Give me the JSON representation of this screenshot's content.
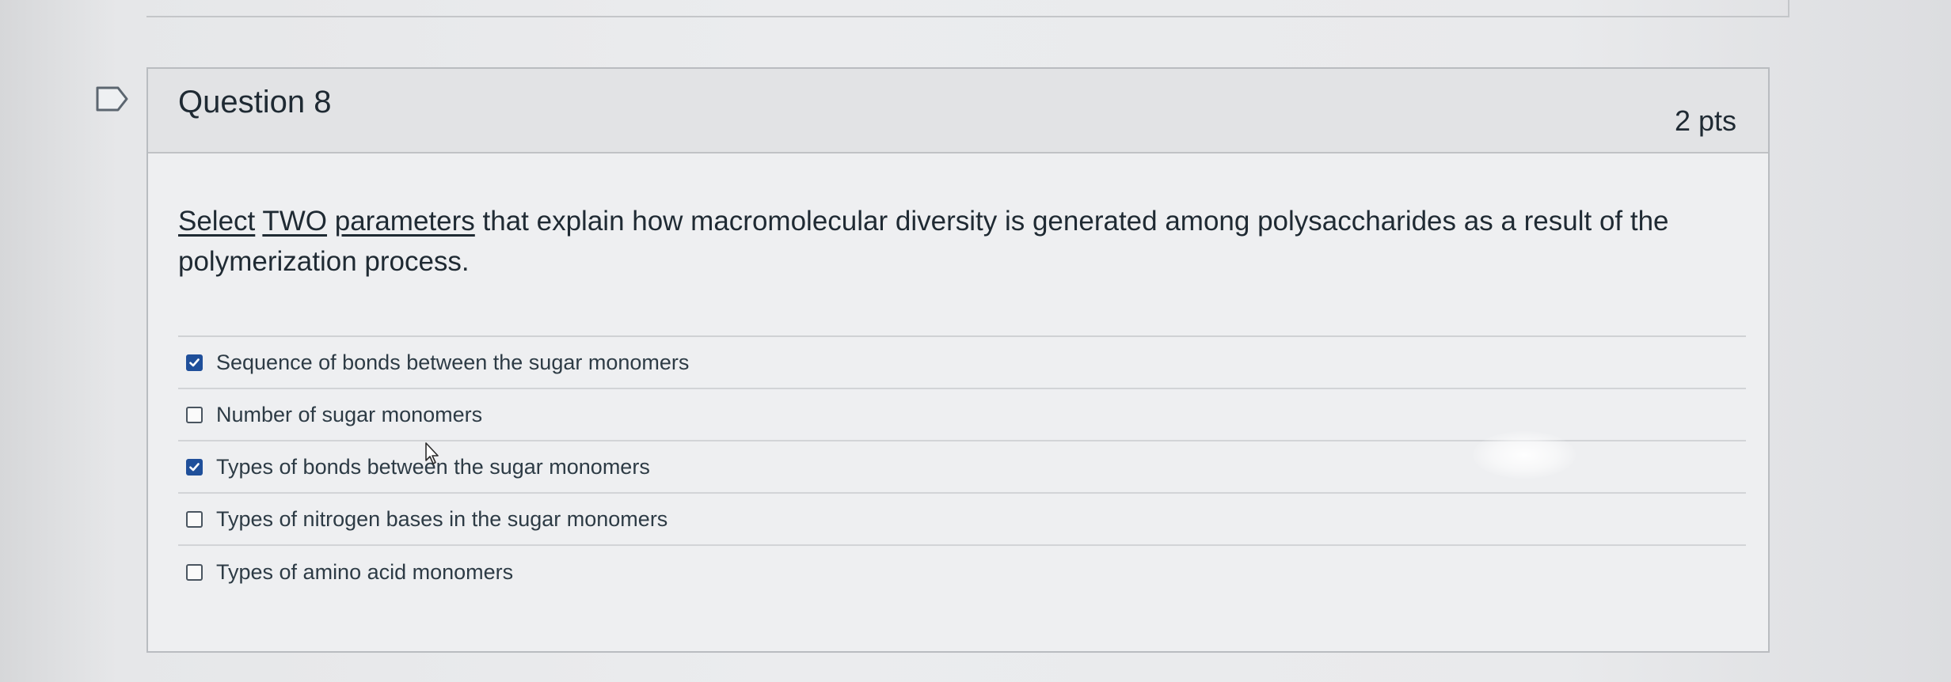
{
  "question": {
    "title": "Question 8",
    "points": "2 pts",
    "text_parts": {
      "select": "Select",
      "two": "TWO",
      "parameters": "parameters",
      "rest": "that explain how macromolecular diversity is generated among polysaccharides as a result of the polymerization process."
    },
    "answers": [
      {
        "label": "Sequence of bonds between the sugar monomers",
        "checked": true
      },
      {
        "label": "Number of sugar monomers",
        "checked": false
      },
      {
        "label": "Types of bonds between the sugar monomers",
        "checked": true
      },
      {
        "label": "Types of nitrogen bases in the sugar monomers",
        "checked": false
      },
      {
        "label": "Types of amino acid monomers",
        "checked": false
      }
    ]
  },
  "icons": {
    "flag": "flag-icon",
    "cursor": "cursor-icon",
    "check": "check-icon"
  },
  "colors": {
    "checkbox_checked": "#1f4f9a",
    "text": "#1f2a33",
    "header_bg": "#e2e3e5"
  }
}
